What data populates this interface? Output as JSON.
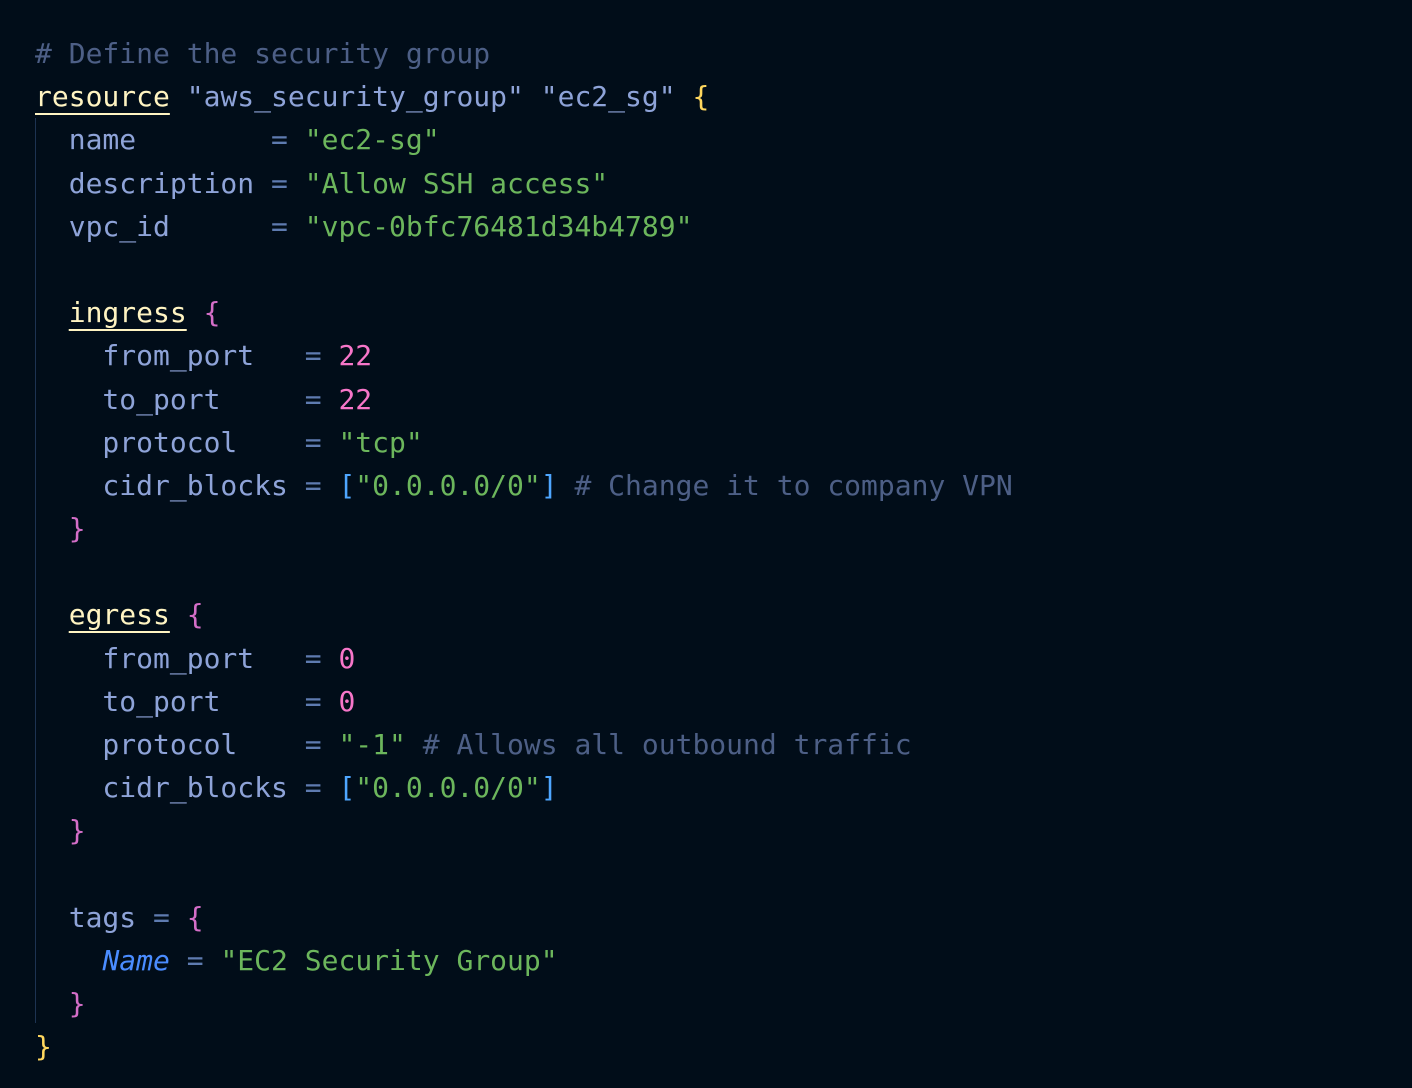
{
  "editor": {
    "theme_colors": {
      "background": "#010d19",
      "comment": "#4d5f86",
      "keyword": "#fff4c2",
      "string": "#6cb65c",
      "number": "#f776c9",
      "attribute": "#8ea3d8",
      "operator": "#5e7bb0",
      "bracket": "#4ea6ff",
      "brace_outer": "#ffd75e",
      "brace_inner": "#d46ec8"
    },
    "lines": [
      [
        {
          "t": "# Define the security group",
          "c": "comment"
        }
      ],
      [
        {
          "t": "resource",
          "c": "keyword"
        },
        {
          "t": " ",
          "c": "op"
        },
        {
          "t": "\"aws_security_group\"",
          "c": "attr"
        },
        {
          "t": " ",
          "c": "op"
        },
        {
          "t": "\"ec2_sg\"",
          "c": "attr"
        },
        {
          "t": " ",
          "c": "op"
        },
        {
          "t": "{",
          "c": "brace-y"
        }
      ],
      [
        {
          "t": "  name        ",
          "c": "attr"
        },
        {
          "t": "= ",
          "c": "op"
        },
        {
          "t": "\"ec2-sg\"",
          "c": "string"
        }
      ],
      [
        {
          "t": "  description ",
          "c": "attr"
        },
        {
          "t": "= ",
          "c": "op"
        },
        {
          "t": "\"Allow SSH access\"",
          "c": "string"
        }
      ],
      [
        {
          "t": "  vpc_id      ",
          "c": "attr"
        },
        {
          "t": "= ",
          "c": "op"
        },
        {
          "t": "\"vpc-0bfc76481d34b4789\"",
          "c": "string"
        }
      ],
      [
        {
          "t": "",
          "c": "op"
        }
      ],
      [
        {
          "t": "  ",
          "c": "op"
        },
        {
          "t": "ingress",
          "c": "keyword"
        },
        {
          "t": " ",
          "c": "op"
        },
        {
          "t": "{",
          "c": "brace-m"
        }
      ],
      [
        {
          "t": "    from_port   ",
          "c": "attr"
        },
        {
          "t": "= ",
          "c": "op"
        },
        {
          "t": "22",
          "c": "num"
        }
      ],
      [
        {
          "t": "    to_port     ",
          "c": "attr"
        },
        {
          "t": "= ",
          "c": "op"
        },
        {
          "t": "22",
          "c": "num"
        }
      ],
      [
        {
          "t": "    protocol    ",
          "c": "attr"
        },
        {
          "t": "= ",
          "c": "op"
        },
        {
          "t": "\"tcp\"",
          "c": "string"
        }
      ],
      [
        {
          "t": "    cidr_blocks ",
          "c": "attr"
        },
        {
          "t": "= ",
          "c": "op"
        },
        {
          "t": "[",
          "c": "bracket"
        },
        {
          "t": "\"0.0.0.0/0\"",
          "c": "string"
        },
        {
          "t": "]",
          "c": "bracket"
        },
        {
          "t": " # Change it to company VPN",
          "c": "comment"
        }
      ],
      [
        {
          "t": "  ",
          "c": "op"
        },
        {
          "t": "}",
          "c": "brace-m"
        }
      ],
      [
        {
          "t": "",
          "c": "op"
        }
      ],
      [
        {
          "t": "  ",
          "c": "op"
        },
        {
          "t": "egress",
          "c": "keyword"
        },
        {
          "t": " ",
          "c": "op"
        },
        {
          "t": "{",
          "c": "brace-m"
        }
      ],
      [
        {
          "t": "    from_port   ",
          "c": "attr"
        },
        {
          "t": "= ",
          "c": "op"
        },
        {
          "t": "0",
          "c": "num"
        }
      ],
      [
        {
          "t": "    to_port     ",
          "c": "attr"
        },
        {
          "t": "= ",
          "c": "op"
        },
        {
          "t": "0",
          "c": "num"
        }
      ],
      [
        {
          "t": "    protocol    ",
          "c": "attr"
        },
        {
          "t": "= ",
          "c": "op"
        },
        {
          "t": "\"-1\"",
          "c": "string"
        },
        {
          "t": " # Allows all outbound traffic",
          "c": "comment"
        }
      ],
      [
        {
          "t": "    cidr_blocks ",
          "c": "attr"
        },
        {
          "t": "= ",
          "c": "op"
        },
        {
          "t": "[",
          "c": "bracket"
        },
        {
          "t": "\"0.0.0.0/0\"",
          "c": "string"
        },
        {
          "t": "]",
          "c": "bracket"
        }
      ],
      [
        {
          "t": "  ",
          "c": "op"
        },
        {
          "t": "}",
          "c": "brace-m"
        }
      ],
      [
        {
          "t": "",
          "c": "op"
        }
      ],
      [
        {
          "t": "  tags ",
          "c": "attr"
        },
        {
          "t": "= ",
          "c": "op"
        },
        {
          "t": "{",
          "c": "brace-m"
        }
      ],
      [
        {
          "t": "    ",
          "c": "op"
        },
        {
          "t": "Name",
          "c": "italic"
        },
        {
          "t": " = ",
          "c": "op"
        },
        {
          "t": "\"EC2 Security Group\"",
          "c": "string"
        }
      ],
      [
        {
          "t": "  ",
          "c": "op"
        },
        {
          "t": "}",
          "c": "brace-m"
        }
      ],
      [
        {
          "t": "}",
          "c": "brace-y"
        }
      ]
    ]
  }
}
